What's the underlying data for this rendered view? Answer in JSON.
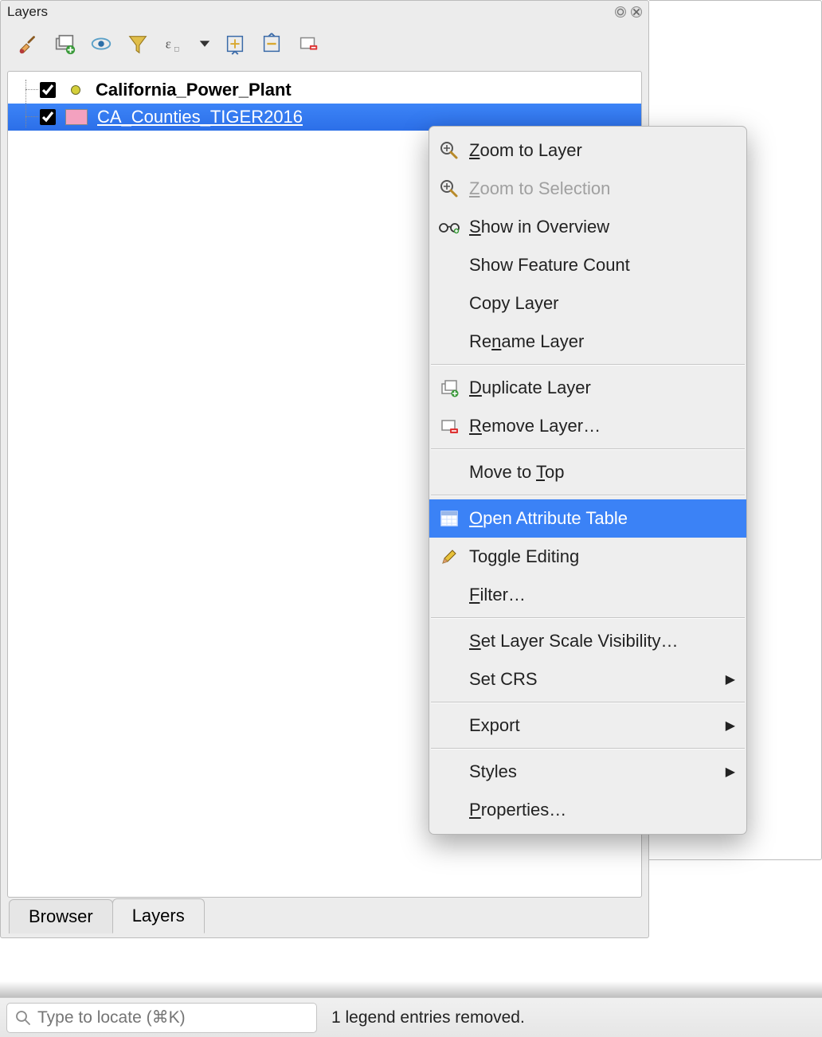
{
  "panel": {
    "title": "Layers"
  },
  "layers": [
    {
      "name": "California_Power_Plant",
      "checked": true,
      "symbol": "point",
      "selected": false,
      "bold": true
    },
    {
      "name": "CA_Counties_TIGER2016",
      "checked": true,
      "symbol": "poly",
      "selected": true,
      "bold": false
    }
  ],
  "toolbar": {
    "items": [
      "style-brush",
      "add-group",
      "visibility-eye",
      "filter-funnel",
      "expression",
      "dropdown-arrow",
      "expand-all",
      "collapse-all",
      "remove-layer"
    ]
  },
  "tabs": {
    "items": [
      "Browser",
      "Layers"
    ],
    "active": 1
  },
  "status": {
    "placeholder": "Type to locate (⌘K)",
    "message": "1 legend entries removed."
  },
  "context_menu": {
    "items": [
      {
        "id": "zoom-layer",
        "icon": "zoom-in-icon",
        "label": "Zoom to Layer",
        "mnemonic": "Z"
      },
      {
        "id": "zoom-selection",
        "icon": "zoom-in-icon",
        "label": "Zoom to Selection",
        "mnemonic": "Z",
        "disabled": true
      },
      {
        "id": "show-overview",
        "icon": "glasses-icon",
        "label": "Show in Overview",
        "mnemonic": "S"
      },
      {
        "id": "feature-count",
        "icon": "",
        "label": "Show Feature Count"
      },
      {
        "id": "copy-layer",
        "icon": "",
        "label": "Copy Layer"
      },
      {
        "id": "rename-layer",
        "icon": "",
        "label": "Rename Layer",
        "mnemonic": "n"
      },
      {
        "sep": true
      },
      {
        "id": "duplicate-layer",
        "icon": "duplicate-icon",
        "label": "Duplicate Layer",
        "mnemonic": "D"
      },
      {
        "id": "remove-layer",
        "icon": "remove-icon",
        "label": "Remove Layer…",
        "mnemonic": "R"
      },
      {
        "sep": true
      },
      {
        "id": "move-top",
        "icon": "",
        "label": "Move to Top",
        "mnemonic": "T"
      },
      {
        "sep": true
      },
      {
        "id": "open-attr-table",
        "icon": "table-icon",
        "label": "Open Attribute Table",
        "mnemonic": "O",
        "highlight": true
      },
      {
        "id": "toggle-editing",
        "icon": "pencil-icon",
        "label": "Toggle Editing"
      },
      {
        "id": "filter",
        "icon": "",
        "label": "Filter…",
        "mnemonic": "F"
      },
      {
        "sep": true
      },
      {
        "id": "scale-vis",
        "icon": "",
        "label": "Set Layer Scale Visibility…",
        "mnemonic": "S"
      },
      {
        "id": "set-crs",
        "icon": "",
        "label": "Set CRS",
        "submenu": true
      },
      {
        "sep": true
      },
      {
        "id": "export",
        "icon": "",
        "label": "Export",
        "submenu": true
      },
      {
        "sep": true
      },
      {
        "id": "styles",
        "icon": "",
        "label": "Styles",
        "submenu": true
      },
      {
        "id": "properties",
        "icon": "",
        "label": "Properties…",
        "mnemonic": "P"
      }
    ]
  }
}
